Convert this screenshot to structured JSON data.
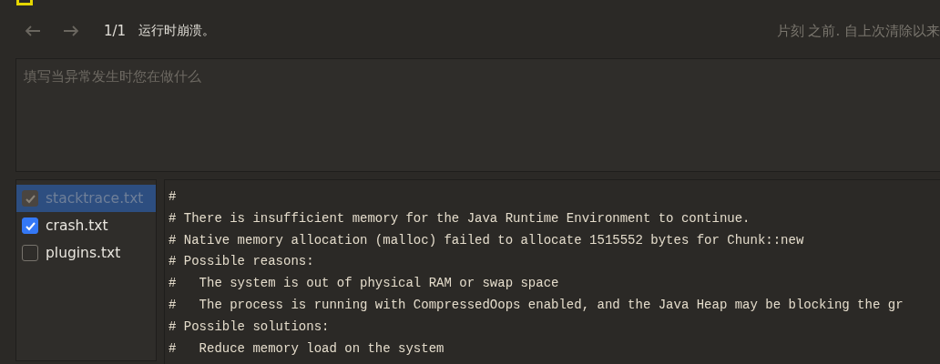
{
  "nav": {
    "counter": "1/1",
    "title": "运行时崩溃。",
    "status": "片刻 之前. 自上次清除以来"
  },
  "description": {
    "placeholder": "填写当异常发生时您在做什么"
  },
  "files": [
    {
      "name": "stacktrace.txt",
      "checked": true,
      "selected": true,
      "disabled": true
    },
    {
      "name": "crash.txt",
      "checked": true,
      "selected": false,
      "disabled": false
    },
    {
      "name": "plugins.txt",
      "checked": false,
      "selected": false,
      "disabled": false
    }
  ],
  "content": [
    "#",
    "# There is insufficient memory for the Java Runtime Environment to continue.",
    "# Native memory allocation (malloc) failed to allocate 1515552 bytes for Chunk::new",
    "# Possible reasons:",
    "#   The system is out of physical RAM or swap space",
    "#   The process is running with CompressedOops enabled, and the Java Heap may be blocking the gr",
    "# Possible solutions:",
    "#   Reduce memory load on the system"
  ]
}
